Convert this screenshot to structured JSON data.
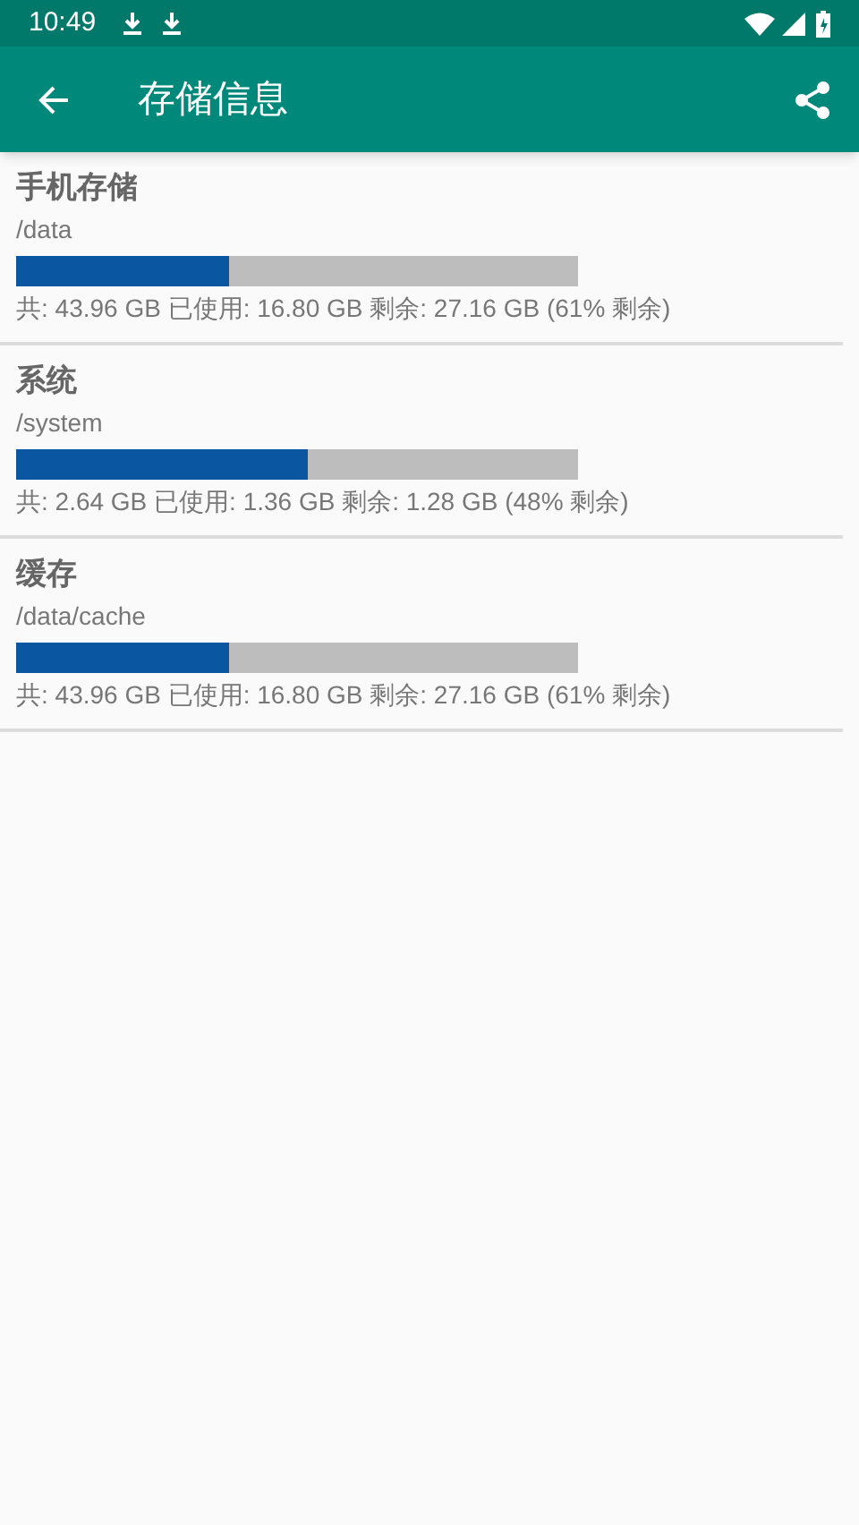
{
  "status_bar": {
    "time": "10:49"
  },
  "app_bar": {
    "title": "存储信息"
  },
  "volumes": [
    {
      "name": "手机存储",
      "path": "/data",
      "level": 0.38,
      "summary": "共: 43.96 GB 已使用: 16.80 GB 剩余: 27.16 GB (61% 剩余)"
    },
    {
      "name": "系统",
      "path": "/system",
      "level": 0.52,
      "summary": "共: 2.64 GB 已使用: 1.36 GB 剩余: 1.28 GB (48% 剩余)"
    },
    {
      "name": "缓存",
      "path": "/data/cache",
      "level": 0.38,
      "summary": "共: 43.96 GB 已使用: 16.80 GB 剩余: 27.16 GB (61% 剩余)"
    }
  ]
}
